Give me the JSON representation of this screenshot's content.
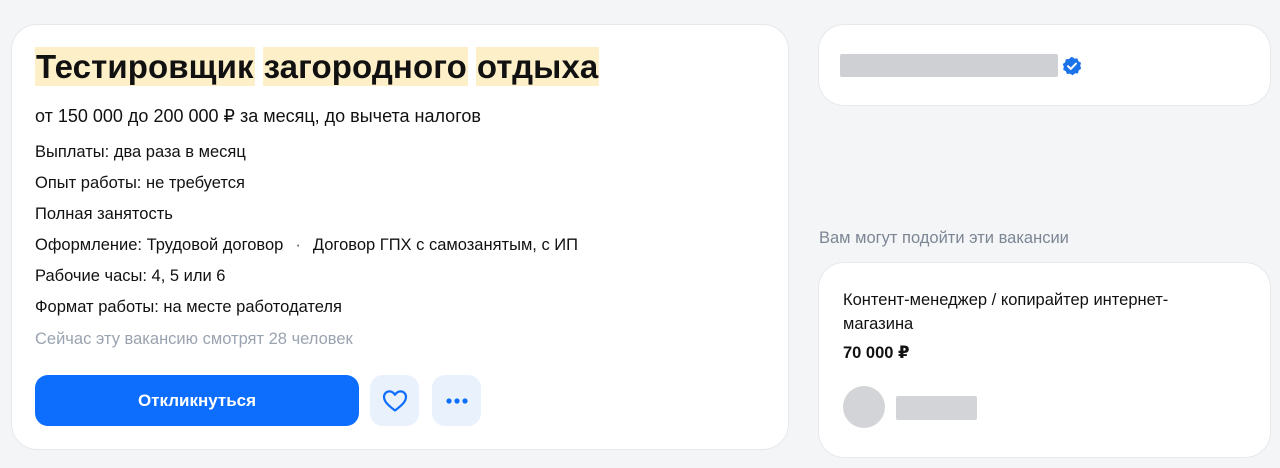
{
  "vacancy": {
    "title_words": [
      "Тестировщик",
      "загородного",
      "отдыха"
    ],
    "salary": "от 150 000 до 200 000 ₽ за месяц, до вычета налогов",
    "details": {
      "payouts": "Выплаты: два раза в месяц",
      "experience": "Опыт работы: не требуется",
      "employment": "Полная занятость",
      "registration_main": "Оформление: Трудовой договор",
      "registration_separator": "·",
      "registration_alt": "Договор ГПХ с самозанятым, с ИП",
      "hours": "Рабочие часы: 4, 5 или 6",
      "work_format": "Формат работы: на месте работодателя"
    },
    "watching": "Сейчас эту вакансию смотрят 28 человек",
    "apply_label": "Откликнуться",
    "fav_icon": "heart-icon",
    "more_icon": "more-dots-icon"
  },
  "employer": {
    "verified_icon": "verified-check-icon"
  },
  "suggestions": {
    "heading": "Вам могут подойти эти вакансии",
    "items": [
      {
        "title": "Контент-менеджер / копирайтер интернет-магазина",
        "price": "70 000 ₽"
      }
    ]
  },
  "colors": {
    "accent": "#0d6efd",
    "highlight": "#fdf0c8",
    "icon_button_bg": "#e9f1fd",
    "muted_text": "#9aa3b0",
    "placeholder": "#cfd0d4"
  }
}
